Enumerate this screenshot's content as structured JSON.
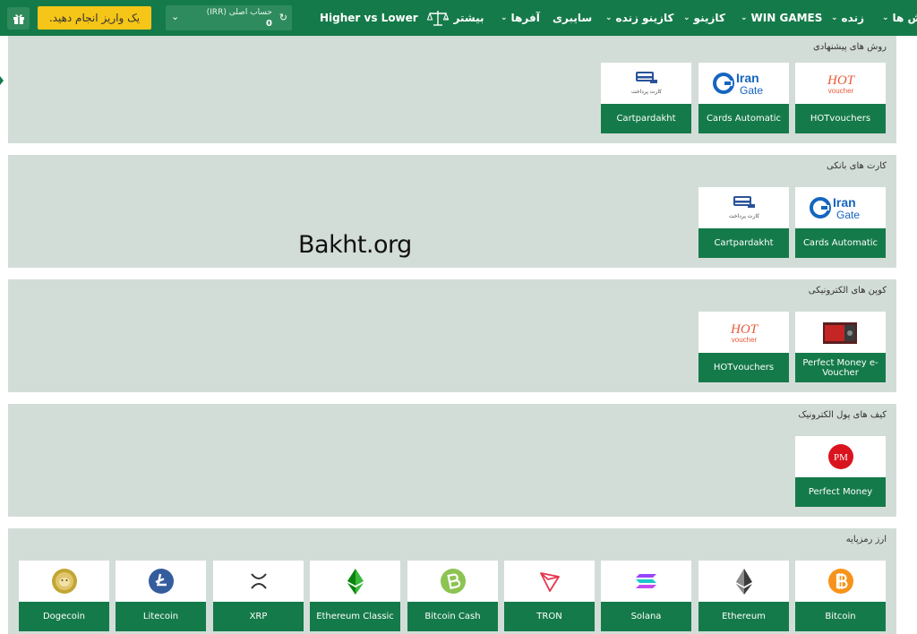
{
  "header": {
    "deposit_label": "یک واریز انجام دهید.",
    "account_label": "حساب اصلی (IRR)",
    "account_value": "0",
    "nav": {
      "higher_lower": "Higher vs Lower",
      "more": "بیشتر",
      "offers": "آفرها",
      "cyber": "سایبری",
      "live_casino": "کازینو زنده",
      "casino": "کازینو",
      "win_games": "WIN GAMES",
      "live": "زنده",
      "sports": "ش ها"
    }
  },
  "sections": [
    {
      "title": "روش های پیشنهادی",
      "items": [
        "HOTvouchers",
        "Cards Automatic",
        "Cartpardakht"
      ]
    },
    {
      "title": "کارت های بانکی",
      "items": [
        "Cards Automatic",
        "Cartpardakht"
      ]
    },
    {
      "title": "کوپن های الکترونیکی",
      "items": [
        "Perfect Money e-Voucher",
        "HOTvouchers"
      ]
    },
    {
      "title": "کیف های پول الکترونیک",
      "items": [
        "Perfect Money"
      ]
    },
    {
      "title": "ارز رمزپایه",
      "items": [
        "Bitcoin",
        "Ethereum",
        "Solana",
        "TRON",
        "Bitcoin Cash",
        "Ethereum Classic",
        "XRP",
        "Litecoin",
        "Dogecoin"
      ]
    }
  ],
  "logos": {
    "irangate_top": "Iran",
    "irangate_bottom": "Gate",
    "hot_top": "HOT",
    "hot_bottom": "voucher",
    "cart_text": "کارت پرداخت",
    "pm": "PM"
  },
  "watermark": "Bakht.org",
  "colors": {
    "primary": "#157a4a",
    "accent": "#f5c518",
    "section_bg": "#d3ddd8"
  }
}
